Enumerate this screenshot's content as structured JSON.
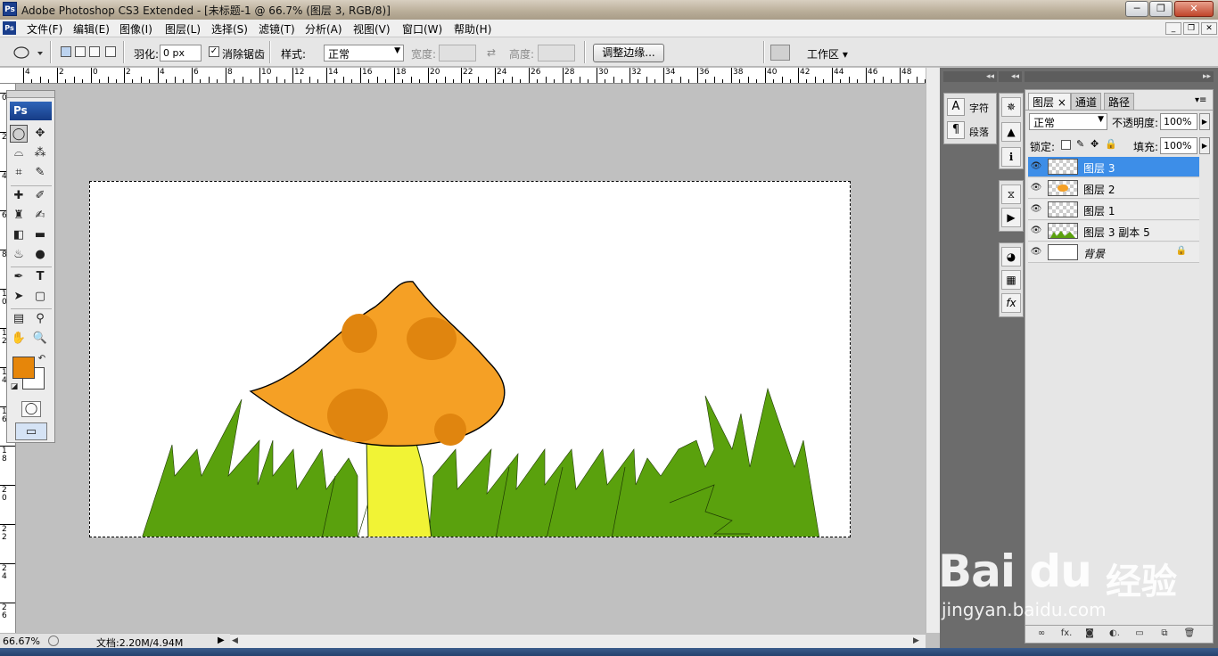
{
  "window": {
    "app_icon": "Ps",
    "title": "Adobe Photoshop CS3 Extended - [未标题-1 @ 66.7% (图层 3, RGB/8)]",
    "min": "─",
    "max": "❐",
    "close": "✕"
  },
  "menubar": {
    "items": [
      "文件(F)",
      "编辑(E)",
      "图像(I)",
      "图层(L)",
      "选择(S)",
      "滤镜(T)",
      "分析(A)",
      "视图(V)",
      "窗口(W)",
      "帮助(H)"
    ],
    "mdi": [
      "_",
      "❐",
      "✕"
    ]
  },
  "options": {
    "feather_label": "羽化:",
    "feather_value": "0 px",
    "antialias_label": "消除锯齿",
    "antialias_checked": true,
    "style_label": "样式:",
    "style_value": "正常",
    "width_label": "宽度:",
    "height_label": "高度:",
    "refine_button": "调整边缘...",
    "workspace_label": "工作区 ▾"
  },
  "ruler": {
    "top_ticks": [
      "4",
      "2",
      "0",
      "2",
      "4",
      "6",
      "8",
      "10",
      "12",
      "14",
      "16",
      "18",
      "20",
      "22",
      "24",
      "26",
      "28",
      "30",
      "32",
      "34",
      "36",
      "38",
      "40",
      "42",
      "44",
      "46",
      "48"
    ],
    "left_ticks": [
      "0",
      "2",
      "4",
      "6",
      "8",
      "10",
      "12",
      "14",
      "16",
      "18",
      "20",
      "22",
      "24",
      "26"
    ]
  },
  "toolbox": {
    "logo": "Ps",
    "fg_color": "#e6860a",
    "bg_color": "#ffffff"
  },
  "status": {
    "zoom": "66.67%",
    "doc": "文档:2.20M/4.94M"
  },
  "char_panel": {
    "char_label": "字符",
    "para_label": "段落"
  },
  "layers_panel": {
    "tabs": [
      "图层 ×",
      "通道",
      "路径"
    ],
    "blend_mode": "正常",
    "opacity_label": "不透明度:",
    "opacity_value": "100%",
    "lock_label": "锁定:",
    "fill_label": "填充:",
    "fill_value": "100%",
    "layers": [
      {
        "name": "图层 3",
        "selected": true
      },
      {
        "name": "图层 2",
        "selected": false
      },
      {
        "name": "图层 1",
        "selected": false
      },
      {
        "name": "图层 3 副本 5",
        "selected": false
      },
      {
        "name": "背景",
        "selected": false,
        "locked": true
      }
    ],
    "footer_buttons": [
      "∞",
      "fx.",
      "◙",
      "◐.",
      "▭",
      "⧉",
      "🗑"
    ]
  },
  "canvas": {
    "colors": {
      "cap": "#f5a025",
      "spot": "#e0850f",
      "stem": "#f1f335",
      "grass": "#5aa10d",
      "background": "#ffffff"
    }
  },
  "watermark": {
    "brand": "Bai du",
    "cn": "经验",
    "url": "jingyan.baidu.com"
  }
}
